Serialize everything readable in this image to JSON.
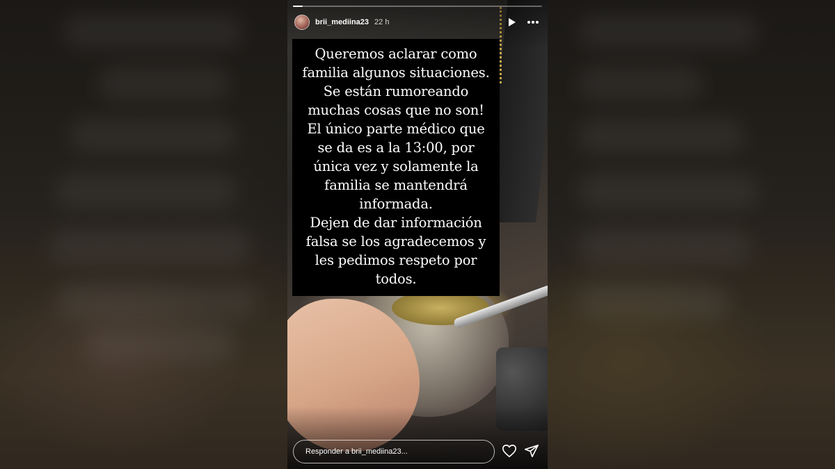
{
  "story": {
    "username": "brii_mediina23",
    "time_ago": "22 h",
    "progress_fraction": 0.04,
    "text_lines": [
      "Queremos aclarar como",
      "familia algunos situaciones.",
      "Se están rumoreando",
      "muchas cosas que no son!",
      "El único parte médico que",
      "se da es a la 13:00, por",
      "única vez y solamente la",
      "familia se mantendrá",
      "informada.",
      "Dejen de dar información",
      "falsa se los agradecemos y",
      "les pedimos respeto por",
      "todos."
    ],
    "reply_placeholder": "Responder a brii_mediina23..."
  },
  "icons": {
    "play": "play-icon",
    "more": "more-horizontal-icon",
    "heart": "heart-icon",
    "send": "send-icon"
  },
  "colors": {
    "text_box_bg": "#000000",
    "text": "#ffffff"
  }
}
